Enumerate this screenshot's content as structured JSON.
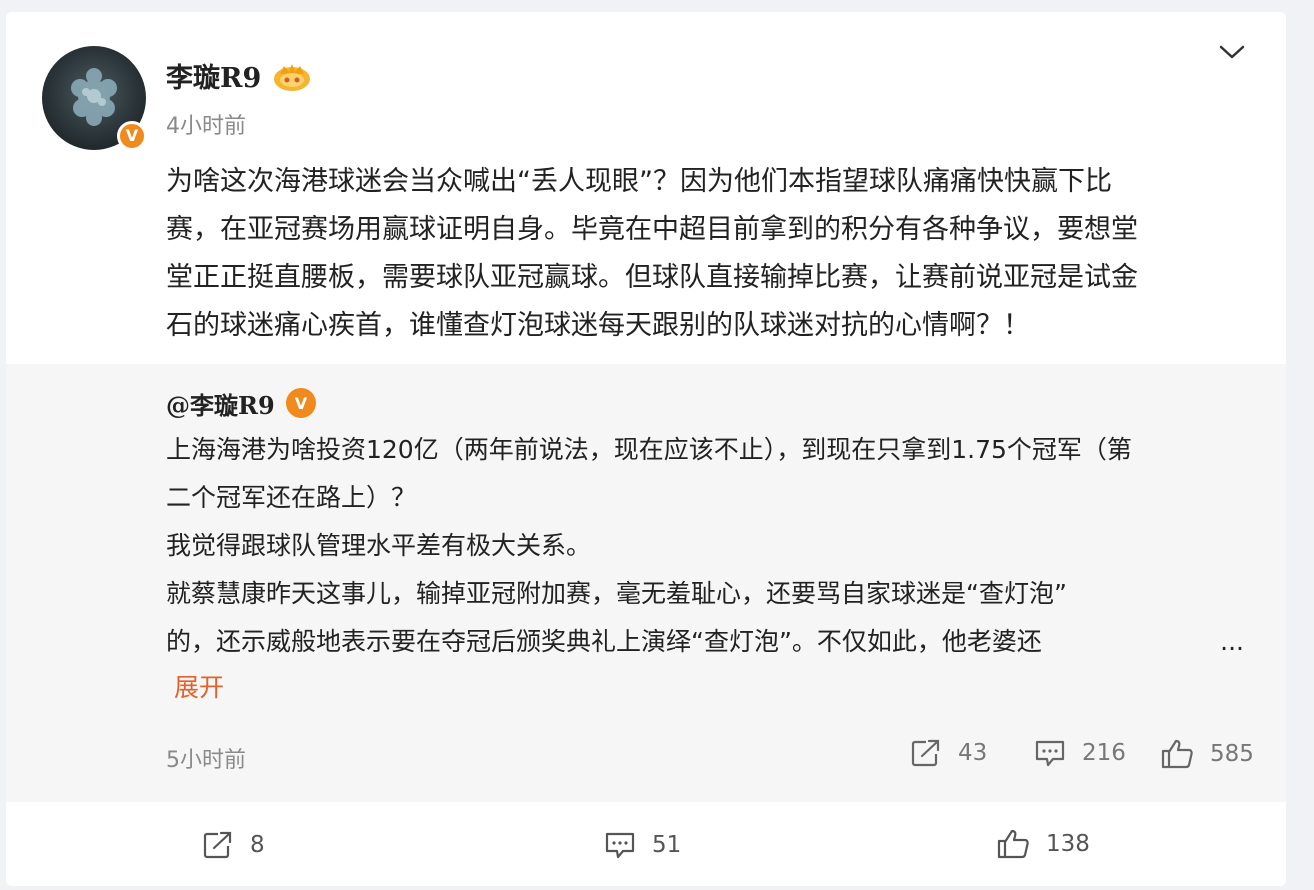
{
  "post": {
    "author": "李璇R9",
    "time": "4小时前",
    "lines": [
      "为啥这次海港球迷会当众喊出“丢人现眼”？因为他们本指望球队痛痛快快赢下比",
      "赛，在亚冠赛场用赢球证明自身。毕竟在中超目前拿到的积分有各种争议，要想堂",
      "堂正正挺直腰板，需要球队亚冠赢球。但球队直接输掉比赛，让赛前说亚冠是试金",
      "石的球迷痛心疾首，谁懂查灯泡球迷每天跟别的队球迷对抗的心情啊？！"
    ],
    "verified_mark": "V"
  },
  "repost": {
    "author": "@李璇R9",
    "lines": [
      "上海海港为啥投资120亿（两年前说法，现在应该不止），到现在只拿到1.75个冠军（第",
      "二个冠军还在路上）？",
      "我觉得跟球队管理水平差有极大关系。",
      "就蔡慧康昨天这事儿，输掉亚冠附加赛，毫无羞耻心，还要骂自家球迷是“查灯泡”",
      "的，还示威般地表示要在夺冠后颁奖典礼上演绎“查灯泡”。不仅如此，他老婆还"
    ],
    "ellipsis": "...",
    "expand_label": "展开",
    "time": "5小时前",
    "repost_count": "43",
    "comment_count": "216",
    "like_count": "585"
  },
  "actions": {
    "repost_count": "8",
    "comment_count": "51",
    "like_count": "138"
  },
  "colors": {
    "accent_orange": "#e3622a",
    "verified_orange": "#f08a1c"
  },
  "icons": [
    "verified-icon",
    "vip-crown-icon",
    "chevron-down-icon",
    "share-icon",
    "comment-icon",
    "like-icon"
  ]
}
